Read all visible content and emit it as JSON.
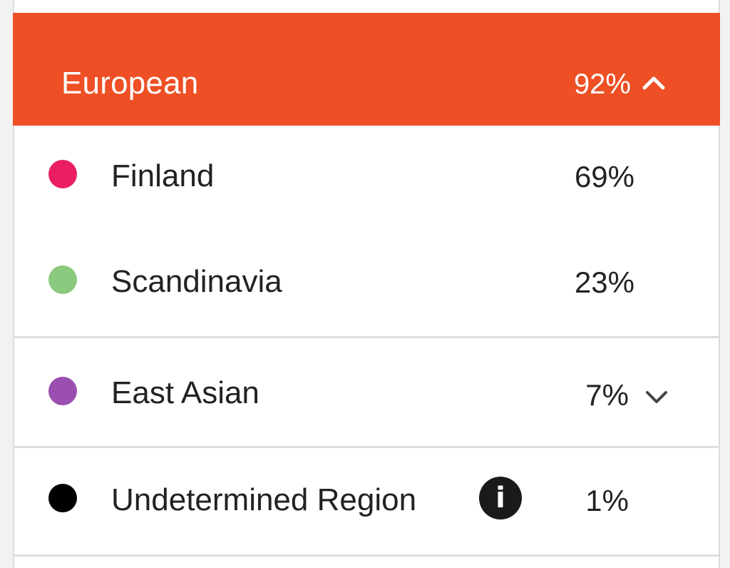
{
  "header": {
    "title": "European",
    "percent": "92%",
    "icon": "chevron-up-icon",
    "color": "#ee4f24"
  },
  "subregions": [
    {
      "label": "Finland",
      "percent": "69%",
      "color": "#e91e63"
    },
    {
      "label": "Scandinavia",
      "percent": "23%",
      "color": "#8bc97f"
    }
  ],
  "east_asian": {
    "label": "East Asian",
    "percent": "7%",
    "color": "#9b4fb0",
    "icon": "chevron-down-icon"
  },
  "undetermined": {
    "label": "Undetermined Region",
    "percent": "1%",
    "color": "#000000",
    "info_glyph": "i",
    "icon": "info-icon"
  }
}
